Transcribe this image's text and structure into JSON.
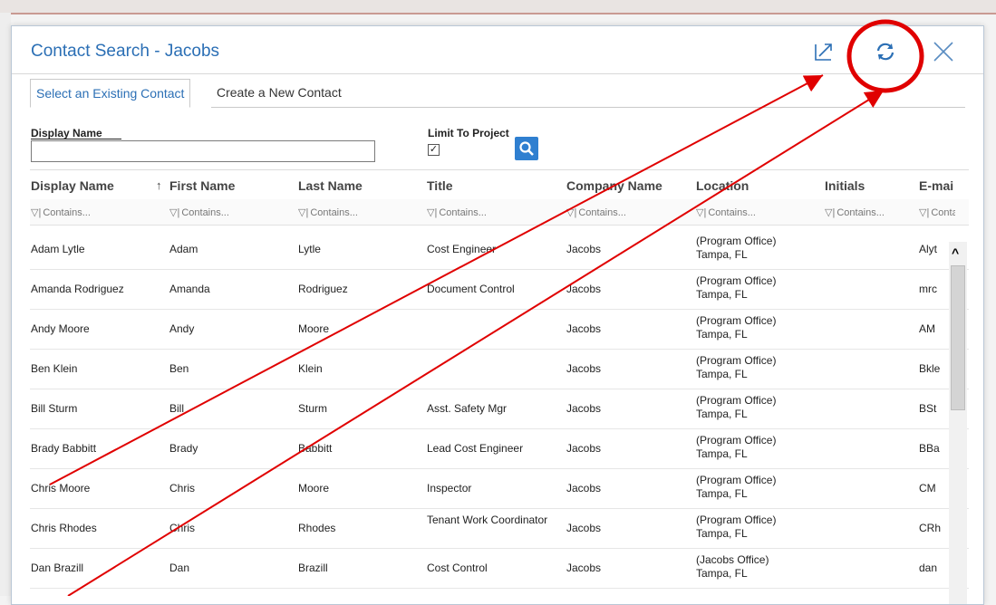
{
  "dialog": {
    "title": "Contact Search - Jacobs"
  },
  "tabs": [
    {
      "label": "Select an Existing Contact",
      "active": true
    },
    {
      "label": "Create a New Contact",
      "active": false
    }
  ],
  "filters": {
    "display_name_label": "Display Name",
    "display_name_value": "",
    "limit_label": "Limit To Project",
    "limit_checked": "✓"
  },
  "columns": [
    "Display Name",
    "First Name",
    "Last Name",
    "Title",
    "Company Name",
    "Location",
    "Initials",
    "E-mai"
  ],
  "sort_indicator": "↑",
  "filter_placeholder": "Contains...",
  "rows": [
    {
      "display": "Adam Lytle",
      "first": "Adam",
      "last": "Lytle",
      "title": "Cost Engineer",
      "company": "Jacobs",
      "loc1": "(Program Office)",
      "loc2": "Tampa, FL",
      "initials": "",
      "email": "Alyt"
    },
    {
      "display": "Amanda Rodriguez",
      "first": "Amanda",
      "last": "Rodriguez",
      "title": "Document Control",
      "company": "Jacobs",
      "loc1": "(Program Office)",
      "loc2": "Tampa, FL",
      "initials": "",
      "email": "mrc"
    },
    {
      "display": "Andy Moore",
      "first": "Andy",
      "last": "Moore",
      "title": "",
      "company": "Jacobs",
      "loc1": "(Program Office)",
      "loc2": "Tampa, FL",
      "initials": "",
      "email": "AM"
    },
    {
      "display": "Ben Klein",
      "first": "Ben",
      "last": "Klein",
      "title": "",
      "company": "Jacobs",
      "loc1": "(Program Office)",
      "loc2": "Tampa, FL",
      "initials": "",
      "email": "Bkle"
    },
    {
      "display": "Bill Sturm",
      "first": "Bill",
      "last": "Sturm",
      "title": "Asst. Safety Mgr",
      "company": "Jacobs",
      "loc1": "(Program Office)",
      "loc2": "Tampa, FL",
      "initials": "",
      "email": "BSt"
    },
    {
      "display": "Brady Babbitt",
      "first": "Brady",
      "last": "Babbitt",
      "title": "Lead Cost Engineer",
      "company": "Jacobs",
      "loc1": "(Program Office)",
      "loc2": "Tampa, FL",
      "initials": "",
      "email": "BBa"
    },
    {
      "display": "Chris Moore",
      "first": "Chris",
      "last": "Moore",
      "title": "Inspector",
      "company": "Jacobs",
      "loc1": "(Program Office)",
      "loc2": "Tampa, FL",
      "initials": "",
      "email": "CM"
    },
    {
      "display": "Chris Rhodes",
      "first": "Chris",
      "last": "Rhodes",
      "title": "Tenant Work Coordinator",
      "company": "Jacobs",
      "loc1": "(Program Office)",
      "loc2": "Tampa, FL",
      "initials": "",
      "email": "CRh"
    },
    {
      "display": "Dan Brazill",
      "first": "Dan",
      "last": "Brazill",
      "title": "Cost Control",
      "company": "Jacobs",
      "loc1": "(Jacobs Office)",
      "loc2": "Tampa, FL",
      "initials": "",
      "email": "dan"
    }
  ],
  "icons": {
    "export": "export-icon",
    "refresh": "refresh-icon",
    "close": "close-icon",
    "search": "search-icon",
    "funnel": "filter-funnel-icon",
    "scroll_up": "chevron-up-icon"
  },
  "colors": {
    "accent": "#2b6fb5",
    "annotation": "#e00000",
    "search_button": "#2f7fd0"
  }
}
